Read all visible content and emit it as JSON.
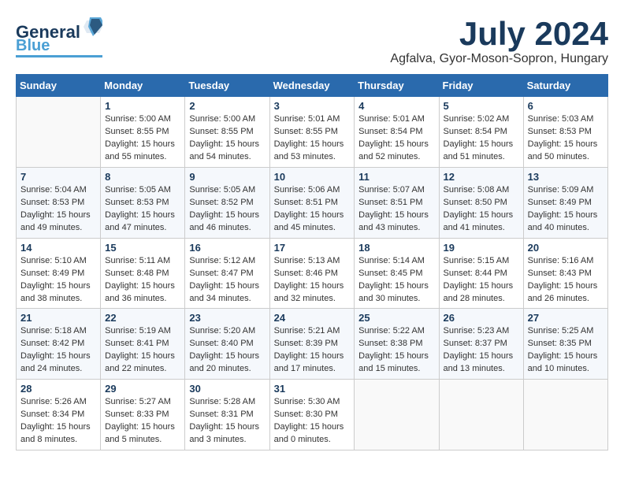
{
  "logo": {
    "line1": "General",
    "line2": "Blue"
  },
  "title": "July 2024",
  "location": "Agfalva, Gyor-Moson-Sopron, Hungary",
  "days_of_week": [
    "Sunday",
    "Monday",
    "Tuesday",
    "Wednesday",
    "Thursday",
    "Friday",
    "Saturday"
  ],
  "weeks": [
    [
      {
        "day": null
      },
      {
        "day": "1",
        "sunrise": "5:00 AM",
        "sunset": "8:55 PM",
        "daylight": "15 hours and 55 minutes."
      },
      {
        "day": "2",
        "sunrise": "5:00 AM",
        "sunset": "8:55 PM",
        "daylight": "15 hours and 54 minutes."
      },
      {
        "day": "3",
        "sunrise": "5:01 AM",
        "sunset": "8:55 PM",
        "daylight": "15 hours and 53 minutes."
      },
      {
        "day": "4",
        "sunrise": "5:01 AM",
        "sunset": "8:54 PM",
        "daylight": "15 hours and 52 minutes."
      },
      {
        "day": "5",
        "sunrise": "5:02 AM",
        "sunset": "8:54 PM",
        "daylight": "15 hours and 51 minutes."
      },
      {
        "day": "6",
        "sunrise": "5:03 AM",
        "sunset": "8:53 PM",
        "daylight": "15 hours and 50 minutes."
      }
    ],
    [
      {
        "day": "7",
        "sunrise": "5:04 AM",
        "sunset": "8:53 PM",
        "daylight": "15 hours and 49 minutes."
      },
      {
        "day": "8",
        "sunrise": "5:05 AM",
        "sunset": "8:53 PM",
        "daylight": "15 hours and 47 minutes."
      },
      {
        "day": "9",
        "sunrise": "5:05 AM",
        "sunset": "8:52 PM",
        "daylight": "15 hours and 46 minutes."
      },
      {
        "day": "10",
        "sunrise": "5:06 AM",
        "sunset": "8:51 PM",
        "daylight": "15 hours and 45 minutes."
      },
      {
        "day": "11",
        "sunrise": "5:07 AM",
        "sunset": "8:51 PM",
        "daylight": "15 hours and 43 minutes."
      },
      {
        "day": "12",
        "sunrise": "5:08 AM",
        "sunset": "8:50 PM",
        "daylight": "15 hours and 41 minutes."
      },
      {
        "day": "13",
        "sunrise": "5:09 AM",
        "sunset": "8:49 PM",
        "daylight": "15 hours and 40 minutes."
      }
    ],
    [
      {
        "day": "14",
        "sunrise": "5:10 AM",
        "sunset": "8:49 PM",
        "daylight": "15 hours and 38 minutes."
      },
      {
        "day": "15",
        "sunrise": "5:11 AM",
        "sunset": "8:48 PM",
        "daylight": "15 hours and 36 minutes."
      },
      {
        "day": "16",
        "sunrise": "5:12 AM",
        "sunset": "8:47 PM",
        "daylight": "15 hours and 34 minutes."
      },
      {
        "day": "17",
        "sunrise": "5:13 AM",
        "sunset": "8:46 PM",
        "daylight": "15 hours and 32 minutes."
      },
      {
        "day": "18",
        "sunrise": "5:14 AM",
        "sunset": "8:45 PM",
        "daylight": "15 hours and 30 minutes."
      },
      {
        "day": "19",
        "sunrise": "5:15 AM",
        "sunset": "8:44 PM",
        "daylight": "15 hours and 28 minutes."
      },
      {
        "day": "20",
        "sunrise": "5:16 AM",
        "sunset": "8:43 PM",
        "daylight": "15 hours and 26 minutes."
      }
    ],
    [
      {
        "day": "21",
        "sunrise": "5:18 AM",
        "sunset": "8:42 PM",
        "daylight": "15 hours and 24 minutes."
      },
      {
        "day": "22",
        "sunrise": "5:19 AM",
        "sunset": "8:41 PM",
        "daylight": "15 hours and 22 minutes."
      },
      {
        "day": "23",
        "sunrise": "5:20 AM",
        "sunset": "8:40 PM",
        "daylight": "15 hours and 20 minutes."
      },
      {
        "day": "24",
        "sunrise": "5:21 AM",
        "sunset": "8:39 PM",
        "daylight": "15 hours and 17 minutes."
      },
      {
        "day": "25",
        "sunrise": "5:22 AM",
        "sunset": "8:38 PM",
        "daylight": "15 hours and 15 minutes."
      },
      {
        "day": "26",
        "sunrise": "5:23 AM",
        "sunset": "8:37 PM",
        "daylight": "15 hours and 13 minutes."
      },
      {
        "day": "27",
        "sunrise": "5:25 AM",
        "sunset": "8:35 PM",
        "daylight": "15 hours and 10 minutes."
      }
    ],
    [
      {
        "day": "28",
        "sunrise": "5:26 AM",
        "sunset": "8:34 PM",
        "daylight": "15 hours and 8 minutes."
      },
      {
        "day": "29",
        "sunrise": "5:27 AM",
        "sunset": "8:33 PM",
        "daylight": "15 hours and 5 minutes."
      },
      {
        "day": "30",
        "sunrise": "5:28 AM",
        "sunset": "8:31 PM",
        "daylight": "15 hours and 3 minutes."
      },
      {
        "day": "31",
        "sunrise": "5:30 AM",
        "sunset": "8:30 PM",
        "daylight": "15 hours and 0 minutes."
      },
      {
        "day": null
      },
      {
        "day": null
      },
      {
        "day": null
      }
    ]
  ]
}
